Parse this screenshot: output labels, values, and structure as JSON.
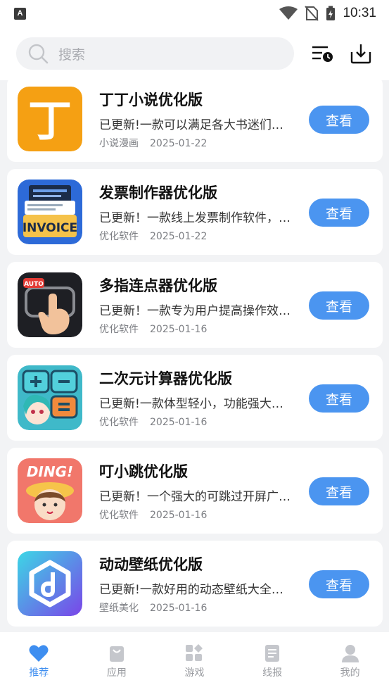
{
  "status_bar": {
    "time": "10:31",
    "left_icon_letter": "A"
  },
  "search": {
    "placeholder": "搜索"
  },
  "header": {
    "history_icon": "history-list-icon",
    "download_icon": "download-icon"
  },
  "apps": [
    {
      "name": "丁丁小说优化版",
      "desc": "已更新!一款可以满足各大书迷们需求的小说阅读软件",
      "category": "小说漫画",
      "date": "2025-01-22",
      "button": "查看",
      "icon": "dingding-app-icon",
      "icon_glyph": "丁"
    },
    {
      "name": "发票制作器优化版",
      "desc": "已更新！一款线上发票制作软件，操作简单",
      "category": "优化软件",
      "date": "2025-01-22",
      "button": "查看",
      "icon": "invoice-app-icon",
      "icon_glyph": "INVOICE"
    },
    {
      "name": "多指连点器优化版",
      "desc": "已更新！一款专为用户提高操作效率的连点工具",
      "category": "优化软件",
      "date": "2025-01-16",
      "button": "查看",
      "icon": "auto-clicker-app-icon",
      "icon_glyph": "AUTO"
    },
    {
      "name": "二次元计算器优化版",
      "desc": "已更新!一款体型轻小，功能强大的计算器",
      "category": "优化软件",
      "date": "2025-01-16",
      "button": "查看",
      "icon": "anime-calculator-app-icon"
    },
    {
      "name": "叮小跳优化版",
      "desc": "已更新！一个强大的可跳过开屏广告的工具",
      "category": "优化软件",
      "date": "2025-01-16",
      "button": "查看",
      "icon": "ding-skip-app-icon",
      "icon_glyph": "DING!"
    },
    {
      "name": "动动壁纸优化版",
      "desc": "已更新!一款好用的动态壁纸大全软件",
      "category": "壁纸美化",
      "date": "2025-01-16",
      "button": "查看",
      "icon": "wallpaper-app-icon"
    }
  ],
  "nav": [
    {
      "label": "推荐",
      "icon": "heart-icon",
      "active": true
    },
    {
      "label": "应用",
      "icon": "bag-icon",
      "active": false
    },
    {
      "label": "游戏",
      "icon": "grid-icon",
      "active": false
    },
    {
      "label": "线报",
      "icon": "news-icon",
      "active": false
    },
    {
      "label": "我的",
      "icon": "user-icon",
      "active": false
    }
  ],
  "colors": {
    "accent": "#4b95f0",
    "nav_active": "#3e8ef0",
    "background": "#f2f3f5"
  }
}
